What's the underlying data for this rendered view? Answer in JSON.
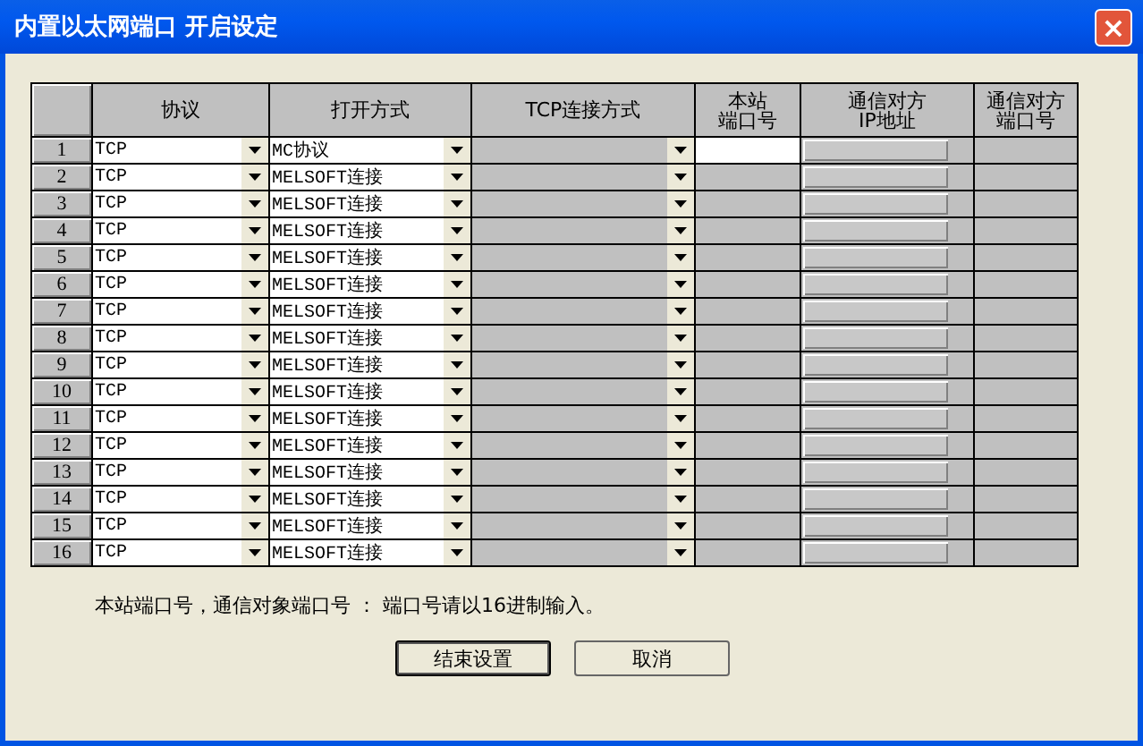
{
  "window": {
    "title": "内置以太网端口 开启设定",
    "close": "×"
  },
  "table": {
    "columns": [
      [
        "协议"
      ],
      [
        "打开方式"
      ],
      [
        "TCP连接方式"
      ],
      [
        "本站",
        "端口号"
      ],
      [
        "通信对方",
        "IP地址"
      ],
      [
        "通信对方",
        "端口号"
      ]
    ],
    "rows": [
      {
        "number": "1",
        "protocol": "TCP",
        "open_method": "MC协议",
        "local_port_disabled": false
      },
      {
        "number": "2",
        "protocol": "TCP",
        "open_method": "MELSOFT连接",
        "local_port_disabled": true
      },
      {
        "number": "3",
        "protocol": "TCP",
        "open_method": "MELSOFT连接",
        "local_port_disabled": true
      },
      {
        "number": "4",
        "protocol": "TCP",
        "open_method": "MELSOFT连接",
        "local_port_disabled": true
      },
      {
        "number": "5",
        "protocol": "TCP",
        "open_method": "MELSOFT连接",
        "local_port_disabled": true
      },
      {
        "number": "6",
        "protocol": "TCP",
        "open_method": "MELSOFT连接",
        "local_port_disabled": true
      },
      {
        "number": "7",
        "protocol": "TCP",
        "open_method": "MELSOFT连接",
        "local_port_disabled": true
      },
      {
        "number": "8",
        "protocol": "TCP",
        "open_method": "MELSOFT连接",
        "local_port_disabled": true
      },
      {
        "number": "9",
        "protocol": "TCP",
        "open_method": "MELSOFT连接",
        "local_port_disabled": true
      },
      {
        "number": "10",
        "protocol": "TCP",
        "open_method": "MELSOFT连接",
        "local_port_disabled": true
      },
      {
        "number": "11",
        "protocol": "TCP",
        "open_method": "MELSOFT连接",
        "local_port_disabled": true
      },
      {
        "number": "12",
        "protocol": "TCP",
        "open_method": "MELSOFT连接",
        "local_port_disabled": true
      },
      {
        "number": "13",
        "protocol": "TCP",
        "open_method": "MELSOFT连接",
        "local_port_disabled": true
      },
      {
        "number": "14",
        "protocol": "TCP",
        "open_method": "MELSOFT连接",
        "local_port_disabled": true
      },
      {
        "number": "15",
        "protocol": "TCP",
        "open_method": "MELSOFT连接",
        "local_port_disabled": true
      },
      {
        "number": "16",
        "protocol": "TCP",
        "open_method": "MELSOFT连接",
        "local_port_disabled": true
      }
    ]
  },
  "note": "本站端口号，通信对象端口号 ： 端口号请以16进制输入。",
  "buttons": [
    "结束设置",
    "取消"
  ]
}
